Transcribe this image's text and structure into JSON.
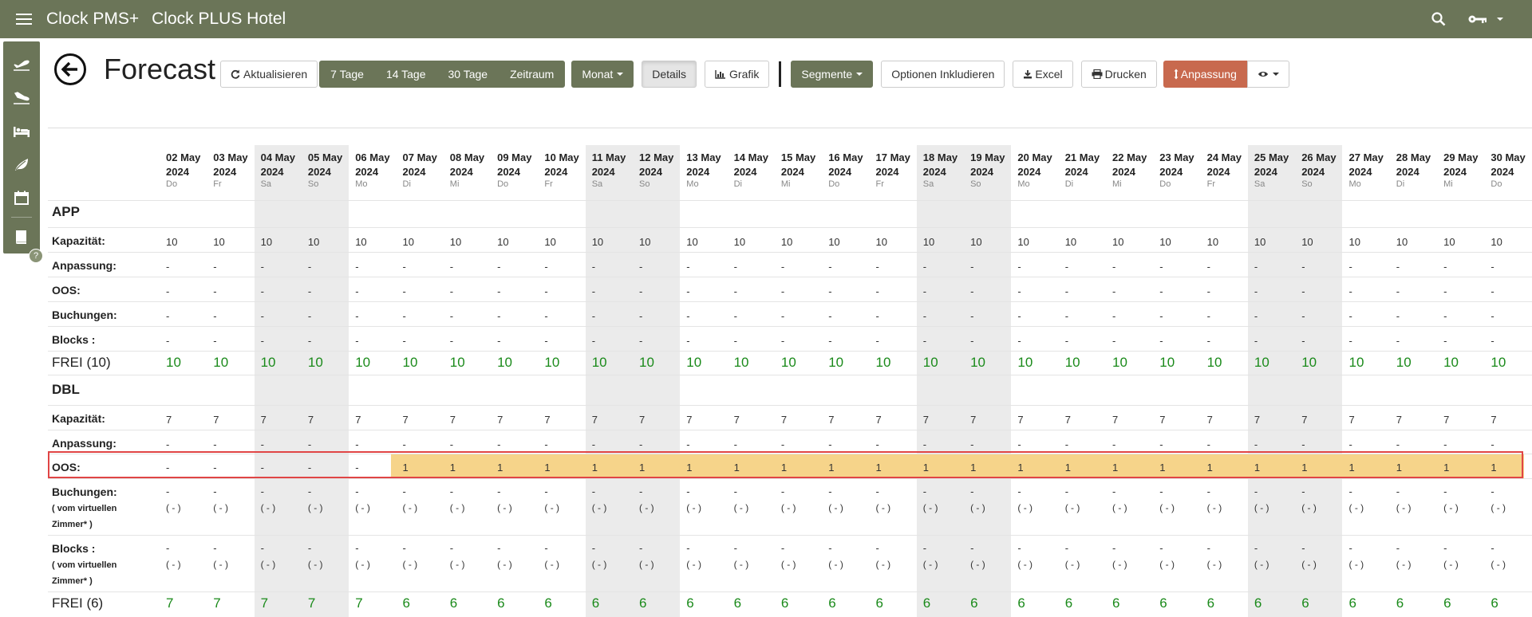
{
  "header": {
    "app_name": "Clock PMS+",
    "hotel_name": "Clock PLUS Hotel"
  },
  "sidebar": {
    "items": [
      "plane-departure-icon",
      "plane-arrival-icon",
      "bed-icon",
      "leaf-icon",
      "calendar-icon",
      "book-icon"
    ],
    "help": "?"
  },
  "page": {
    "title": "Forecast"
  },
  "toolbar": {
    "refresh": "Aktualisieren",
    "periods": [
      "7 Tage",
      "14 Tage",
      "30 Tage",
      "Zeitraum"
    ],
    "month": "Monat",
    "details": "Details",
    "chart": "Grafik",
    "segments": "Segmente",
    "options": "Optionen Inkludieren",
    "excel": "Excel",
    "print": "Drucken",
    "adjust": "Anpassung"
  },
  "dates": [
    {
      "d": "02 May",
      "y": "2024",
      "w": "Do"
    },
    {
      "d": "03 May",
      "y": "2024",
      "w": "Fr"
    },
    {
      "d": "04 May",
      "y": "2024",
      "w": "Sa"
    },
    {
      "d": "05 May",
      "y": "2024",
      "w": "So"
    },
    {
      "d": "06 May",
      "y": "2024",
      "w": "Mo"
    },
    {
      "d": "07 May",
      "y": "2024",
      "w": "Di"
    },
    {
      "d": "08 May",
      "y": "2024",
      "w": "Mi"
    },
    {
      "d": "09 May",
      "y": "2024",
      "w": "Do"
    },
    {
      "d": "10 May",
      "y": "2024",
      "w": "Fr"
    },
    {
      "d": "11 May",
      "y": "2024",
      "w": "Sa"
    },
    {
      "d": "12 May",
      "y": "2024",
      "w": "So"
    },
    {
      "d": "13 May",
      "y": "2024",
      "w": "Mo"
    },
    {
      "d": "14 May",
      "y": "2024",
      "w": "Di"
    },
    {
      "d": "15 May",
      "y": "2024",
      "w": "Mi"
    },
    {
      "d": "16 May",
      "y": "2024",
      "w": "Do"
    },
    {
      "d": "17 May",
      "y": "2024",
      "w": "Fr"
    },
    {
      "d": "18 May",
      "y": "2024",
      "w": "Sa"
    },
    {
      "d": "19 May",
      "y": "2024",
      "w": "So"
    },
    {
      "d": "20 May",
      "y": "2024",
      "w": "Mo"
    },
    {
      "d": "21 May",
      "y": "2024",
      "w": "Di"
    },
    {
      "d": "22 May",
      "y": "2024",
      "w": "Mi"
    },
    {
      "d": "23 May",
      "y": "2024",
      "w": "Do"
    },
    {
      "d": "24 May",
      "y": "2024",
      "w": "Fr"
    },
    {
      "d": "25 May",
      "y": "2024",
      "w": "Sa"
    },
    {
      "d": "26 May",
      "y": "2024",
      "w": "So"
    },
    {
      "d": "27 May",
      "y": "2024",
      "w": "Mo"
    },
    {
      "d": "28 May",
      "y": "2024",
      "w": "Di"
    },
    {
      "d": "29 May",
      "y": "2024",
      "w": "Mi"
    },
    {
      "d": "30 May",
      "y": "2024",
      "w": "Do"
    }
  ],
  "app": {
    "title": "APP",
    "labels": {
      "capacity": "Kapazität:",
      "adjust": "Anpassung:",
      "oos": "OOS:",
      "bookings": "Buchungen:",
      "blocks": "Blocks :"
    },
    "capacity": "10",
    "dash": "-",
    "free_label": "FREI (10)",
    "free": "10"
  },
  "dbl": {
    "title": "DBL",
    "labels": {
      "capacity": "Kapazität:",
      "adjust": "Anpassung:",
      "oos": "OOS:",
      "bookings": "Buchungen:",
      "blocks": "Blocks :",
      "virtual_1": "( vom virtuellen",
      "virtual_2": "Zimmer* )"
    },
    "capacity": "7",
    "dash": "-",
    "virtual_dash": "( - )",
    "oos": [
      "-",
      "-",
      "-",
      "-",
      "-",
      "1",
      "1",
      "1",
      "1",
      "1",
      "1",
      "1",
      "1",
      "1",
      "1",
      "1",
      "1",
      "1",
      "1",
      "1",
      "1",
      "1",
      "1",
      "1",
      "1",
      "1",
      "1",
      "1",
      "1"
    ],
    "free_label": "FREI (6)",
    "free": [
      "7",
      "7",
      "7",
      "7",
      "7",
      "6",
      "6",
      "6",
      "6",
      "6",
      "6",
      "6",
      "6",
      "6",
      "6",
      "6",
      "6",
      "6",
      "6",
      "6",
      "6",
      "6",
      "6",
      "6",
      "6",
      "6",
      "6",
      "6",
      "6"
    ]
  }
}
